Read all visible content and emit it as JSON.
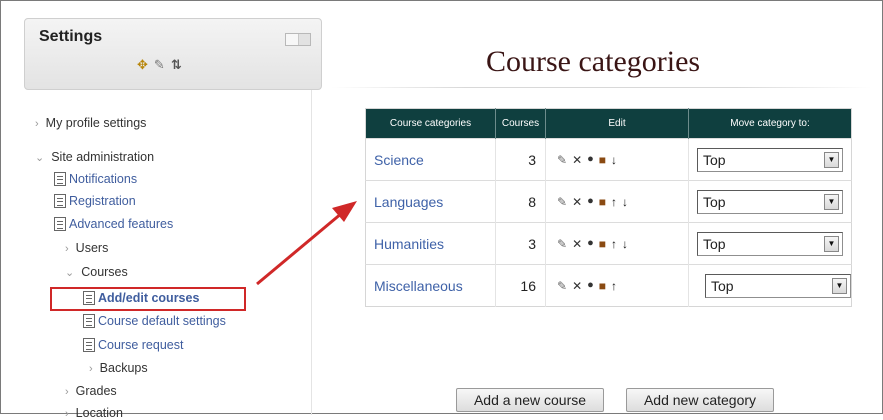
{
  "settings": {
    "title": "Settings",
    "header_icons": [
      "move-icon",
      "edit-icon",
      "move-updown-icon"
    ],
    "tree": {
      "my_profile": "My profile settings",
      "site_admin": "Site administration",
      "notifications": "Notifications",
      "registration": "Registration",
      "advanced_features": "Advanced features",
      "users": "Users",
      "courses": "Courses",
      "add_edit_courses": "Add/edit courses",
      "course_default_settings": "Course default settings",
      "course_request": "Course request",
      "backups": "Backups",
      "grades": "Grades",
      "location": "Location"
    }
  },
  "main": {
    "title": "Course categories",
    "table": {
      "headers": [
        "Course categories",
        "Courses",
        "Edit",
        "Move category to:"
      ],
      "rows": [
        {
          "name": "Science",
          "courses": "3",
          "move_to": "Top",
          "icons": [
            "edit-icon",
            "delete-icon",
            "hide-icon",
            "roles-icon",
            "move-down-icon"
          ]
        },
        {
          "name": "Languages",
          "courses": "8",
          "move_to": "Top",
          "icons": [
            "edit-icon",
            "delete-icon",
            "hide-icon",
            "roles-icon",
            "move-up-icon",
            "move-down-icon"
          ]
        },
        {
          "name": "Humanities",
          "courses": "3",
          "move_to": "Top",
          "icons": [
            "edit-icon",
            "delete-icon",
            "hide-icon",
            "roles-icon",
            "move-up-icon",
            "move-down-icon"
          ]
        },
        {
          "name": "Miscellaneous",
          "courses": "16",
          "move_to": "Top",
          "icons": [
            "edit-icon",
            "delete-icon",
            "hide-icon",
            "roles-icon",
            "move-up-icon"
          ]
        }
      ]
    },
    "buttons": {
      "add_course": "Add a new course",
      "add_category": "Add new category"
    }
  },
  "colors": {
    "table_header_bg": "#0f3f3f",
    "link": "#3f62a8",
    "title": "#3a1515",
    "annotation": "#d02828"
  }
}
